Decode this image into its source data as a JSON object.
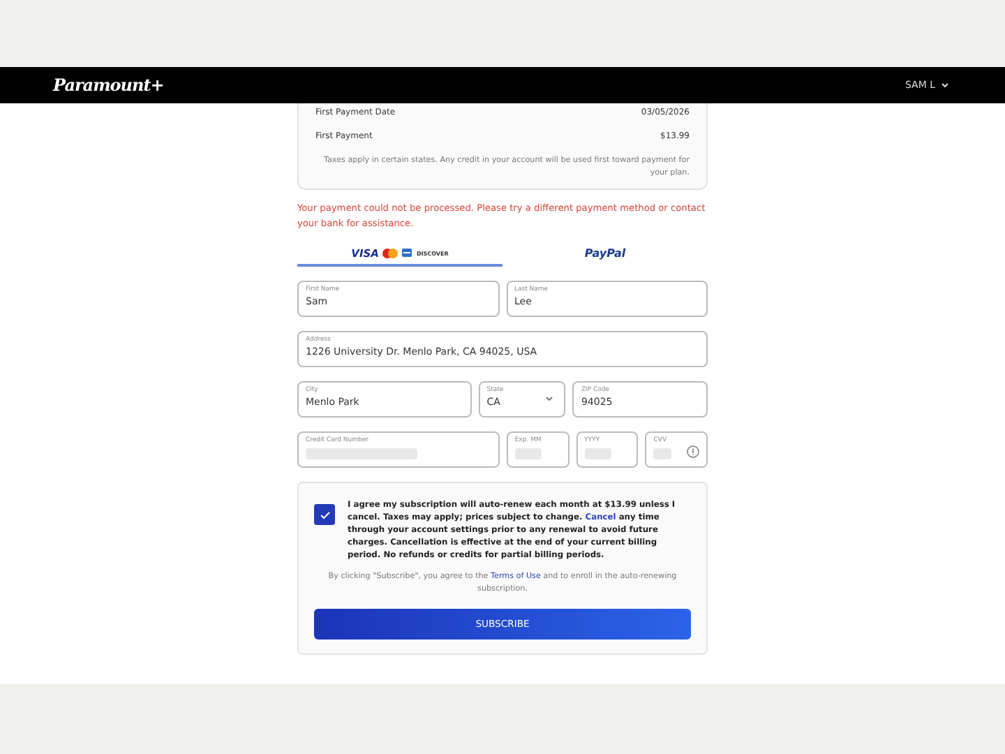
{
  "header": {
    "logo": "Paramount+",
    "user": "SAM L",
    "user_menu_expanded": false
  },
  "summary": {
    "rows": [
      {
        "label": "First Payment Date",
        "value": "03/05/2026"
      },
      {
        "label": "First Payment",
        "value": "$13.99"
      }
    ],
    "note": "Taxes apply in certain states. Any credit in your account will be used first toward payment for your plan."
  },
  "error": "Your payment could not be processed. Please try a different payment method or contact your bank for assistance.",
  "tabs": [
    {
      "kind": "cards",
      "labels": [
        "VISA",
        "DISCOVER"
      ],
      "selected": true
    },
    {
      "kind": "paypal",
      "labels": [
        "PayPal"
      ],
      "selected": false
    }
  ],
  "field_rows": [
    [
      {
        "label": "First Name",
        "value": "Sam",
        "kind": "text"
      },
      {
        "label": "Last Name",
        "value": "Lee",
        "kind": "text"
      }
    ],
    [
      {
        "label": "Address",
        "value": "1226 University Dr. Menlo Park, CA 94025, USA",
        "kind": "text"
      }
    ],
    [
      {
        "label": "City",
        "value": "Menlo Park",
        "kind": "text"
      },
      {
        "label": "State",
        "value": "CA",
        "kind": "select"
      },
      {
        "label": "ZIP Code",
        "value": "94025",
        "kind": "text"
      }
    ],
    [
      {
        "label": "Credit Card Number",
        "kind": "redacted"
      },
      {
        "label": "Exp. MM",
        "kind": "redacted"
      },
      {
        "label": "YYYY",
        "kind": "redacted"
      },
      {
        "label": "CVV",
        "kind": "cvv"
      }
    ]
  ],
  "consent": {
    "checked": true,
    "text_before": "I agree my subscription will auto-renew each month at $13.99 unless I cancel. Taxes may apply; prices subject to change.",
    "link": "Cancel",
    "text_after": "any time through your account settings prior to any renewal to avoid future charges. Cancellation is effective at the end of your current billing period. No refunds or credits for partial billing periods."
  },
  "terms": {
    "text_before": "By clicking \"Subscribe\", you agree to the",
    "link": "Terms of Use",
    "text_after": "and to enroll in the auto-renewing subscription."
  },
  "subscribe_button": "SUBSCRIBE"
}
